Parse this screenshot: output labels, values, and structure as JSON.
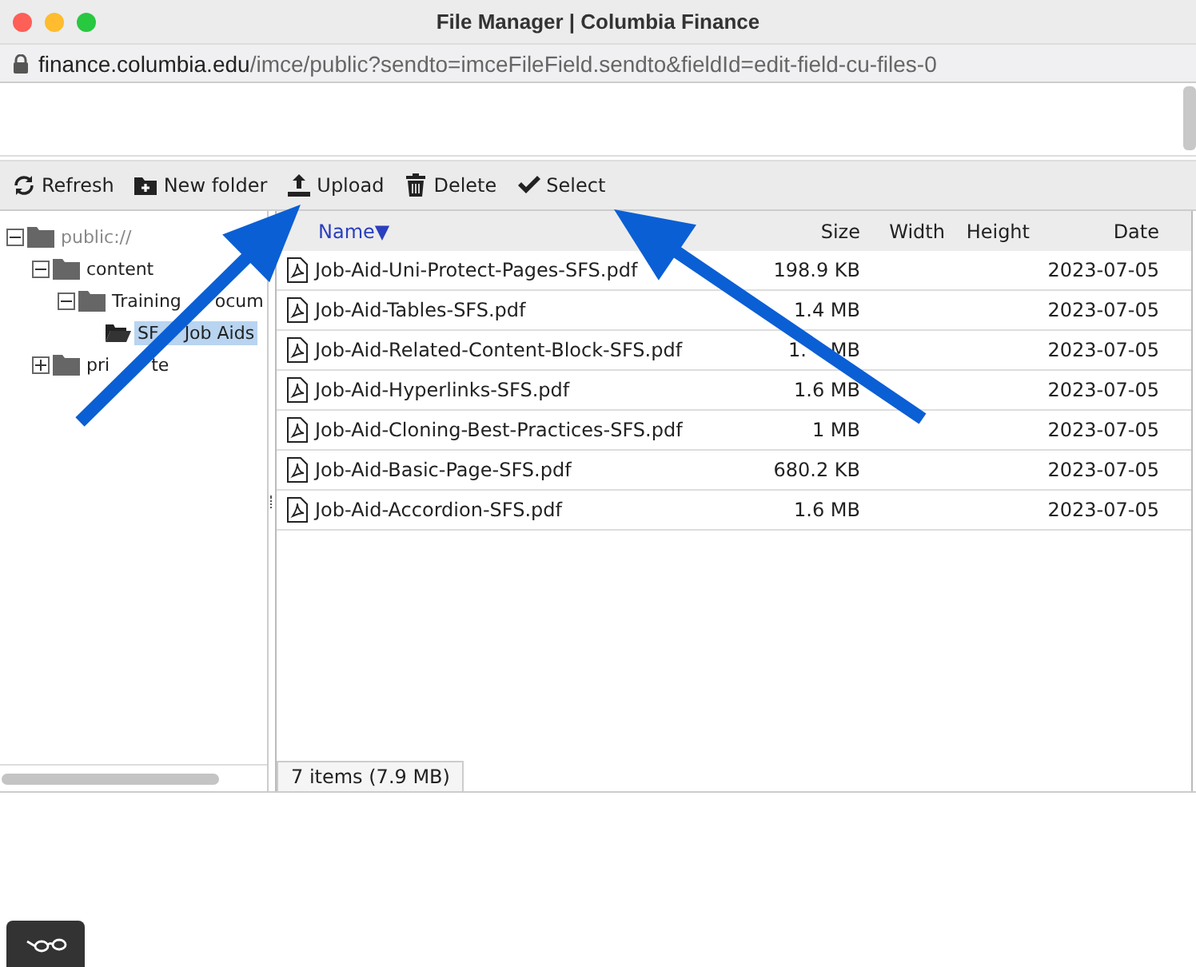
{
  "window": {
    "title": "File Manager | Columbia Finance"
  },
  "address_bar": {
    "host": "finance.columbia.edu",
    "path": "/imce/public?sendto=imceFileField.sendto&fieldId=edit-field-cu-files-0"
  },
  "toolbar": [
    {
      "kind": "refresh",
      "label": "Refresh"
    },
    {
      "kind": "new_folder",
      "label": "New folder"
    },
    {
      "kind": "upload",
      "label": "Upload"
    },
    {
      "kind": "delete",
      "label": "Delete"
    },
    {
      "kind": "select",
      "label": "Select"
    }
  ],
  "tree": [
    {
      "label": "public://",
      "expanded": true,
      "selected": false,
      "children": [
        {
          "label": "content",
          "expanded": true,
          "selected": false,
          "children": [
            {
              "label": "Training",
              "label_rest": "ocum",
              "expanded": true,
              "selected": false,
              "children": [
                {
                  "label": "SF",
                  "label_rest": "Job Aids",
                  "selected": true
                }
              ]
            }
          ]
        },
        {
          "label": "pri",
          "label_rest": "te",
          "expanded": false,
          "selected": false
        }
      ]
    }
  ],
  "table": {
    "columns": [
      {
        "label": "Name",
        "sorted": true
      },
      {
        "label": "Size",
        "sorted": false
      },
      {
        "label": "Width",
        "sorted": false
      },
      {
        "label": "Height",
        "sorted": false
      },
      {
        "label": "Date",
        "sorted": false
      }
    ],
    "sort_indicator": "▼",
    "rows": [
      {
        "name": "Job-Aid-Uni-Protect-Pages-SFS.pdf",
        "size": "198.9 KB",
        "date": "2023-07-05"
      },
      {
        "name": "Job-Aid-Tables-SFS.pdf",
        "size": "1.4 MB",
        "date": "2023-07-05"
      },
      {
        "name": "Job-Aid-Related-Content-Block-SFS.pdf",
        "size": "1.",
        "size_rest": "MB",
        "date": "2023-07-05"
      },
      {
        "name": "Job-Aid-Hyperlinks-SFS.pdf",
        "size": "1.6 MB",
        "date": "2023-07-05"
      },
      {
        "name": "Job-Aid-Cloning-Best-Practices-SFS.pdf",
        "size": "1 MB",
        "date": "2023-07-05"
      },
      {
        "name": "Job-Aid-Basic-Page-SFS.pdf",
        "size": "680.2 KB",
        "date": "2023-07-05"
      },
      {
        "name": "Job-Aid-Accordion-SFS.pdf",
        "size": "1.6 MB",
        "date": "2023-07-05"
      }
    ]
  },
  "status": "7 items (7.9 MB)",
  "annotations": [
    {
      "kind": "arrow"
    },
    {
      "kind": "arrow"
    }
  ]
}
